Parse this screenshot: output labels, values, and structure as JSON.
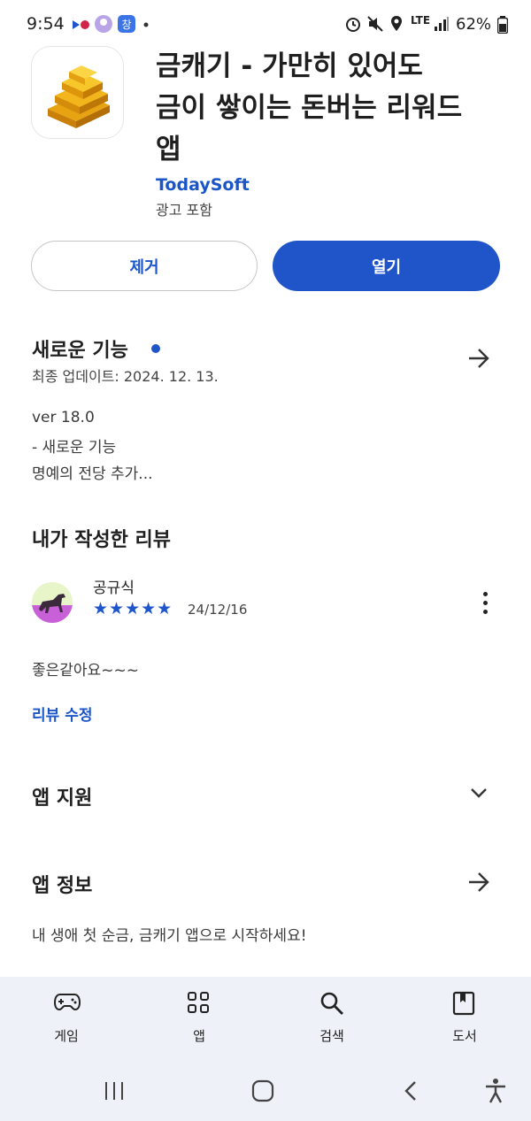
{
  "status_bar": {
    "time": "9:54",
    "battery": "62%",
    "network": "LTE"
  },
  "app": {
    "title": "금캐기 - 가만히 있어도 금이 쌓이는 돈버는 리워드 앱",
    "title_line1": "금캐기 - 가만히 있어도",
    "title_line2": "금이 쌓이는 돈버는 리워드",
    "title_line3": "앱",
    "developer": "TodaySoft",
    "ads_notice": "광고 포함",
    "icon": "gold-bars-icon"
  },
  "actions": {
    "remove_label": "제거",
    "open_label": "열기"
  },
  "whats_new": {
    "title": "새로운 기능",
    "last_updated": "최종 업데이트: 2024. 12. 13.",
    "line1": "ver 18.0",
    "line2": "- 새로운 기능",
    "line3": "명예의 전당 추가..."
  },
  "my_review": {
    "title": "내가 작성한 리뷰",
    "reviewer": "공규식",
    "rating": 5,
    "stars": "★★★★★",
    "date": "24/12/16",
    "text": "좋은같아요~~~",
    "edit_label": "리뷰 수정"
  },
  "app_support": {
    "title": "앱 지원"
  },
  "app_info": {
    "title": "앱 정보",
    "description": "내 생애 첫 순금, 금캐기 앱으로 시작하세요!"
  },
  "bottom_nav": {
    "games": "게임",
    "apps": "앱",
    "search": "검색",
    "books": "도서"
  },
  "colors": {
    "accent": "#1f55c9",
    "link": "#1a56c8",
    "nav_bg": "#eef2f8"
  }
}
